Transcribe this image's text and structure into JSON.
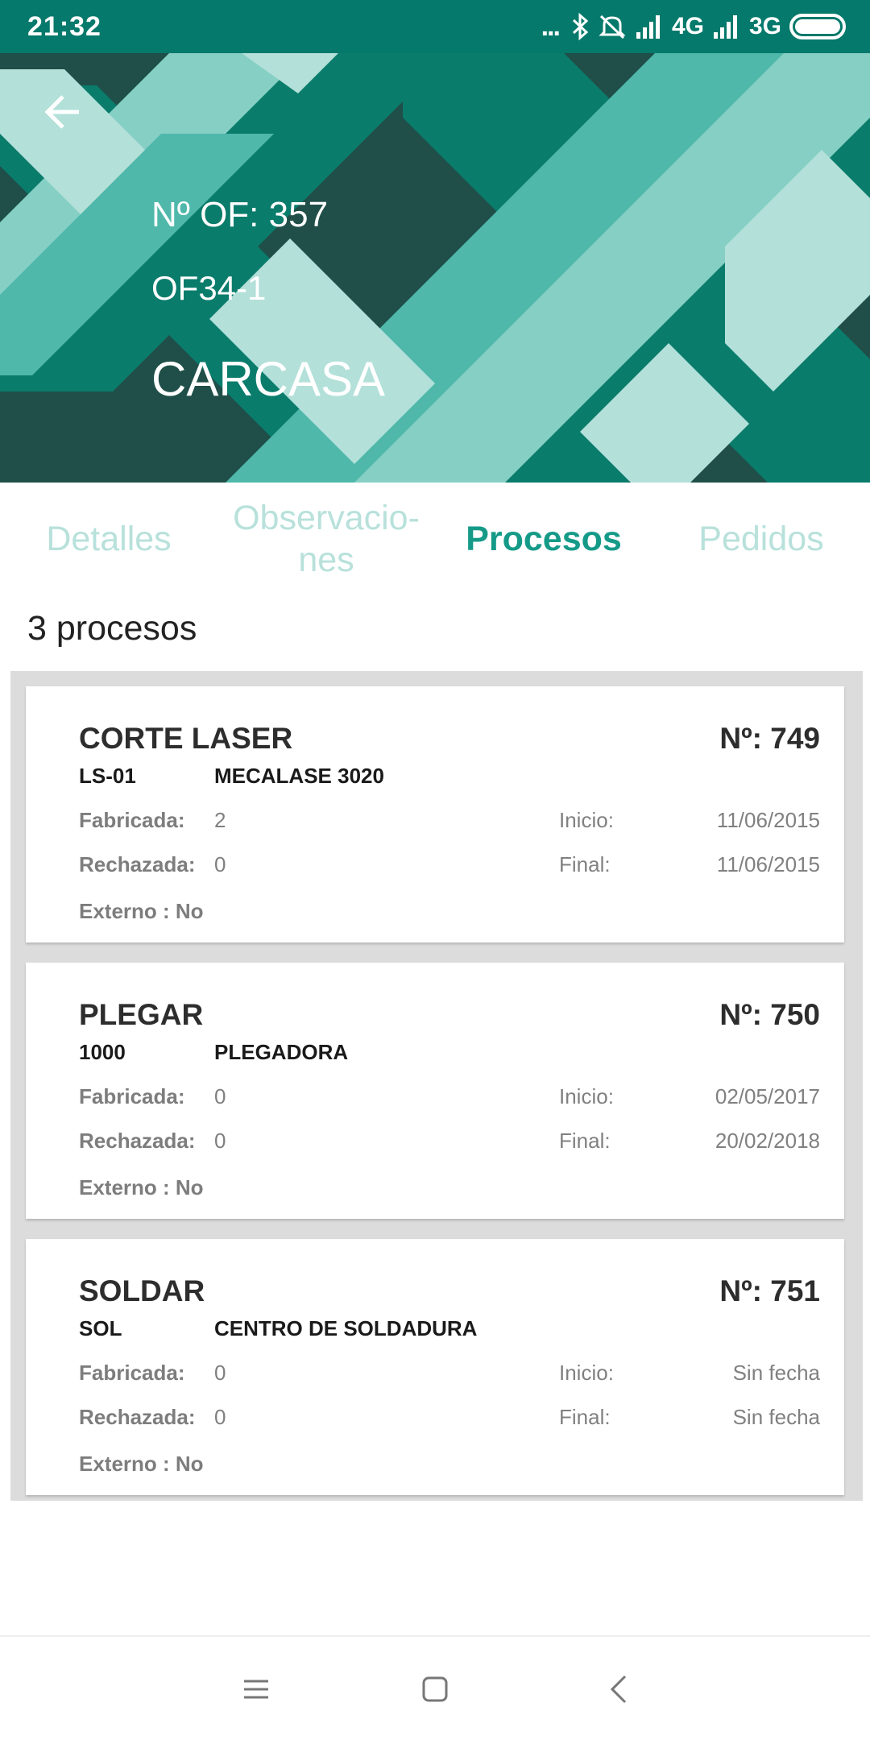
{
  "status_bar": {
    "time": "21:32",
    "dots": "...",
    "network_1": "4G",
    "network_2": "3G",
    "icons": [
      "bluetooth-icon",
      "muted-bell-icon",
      "signal-icon",
      "signal-icon",
      "battery-icon"
    ]
  },
  "header": {
    "of_number": "Nº OF: 357",
    "code": "OF34-1",
    "name": "CARCASA",
    "colors": {
      "dark": "#1f4f48",
      "mid": "#0a7c6c",
      "light": "#4fb8ab",
      "pale": "#86cfc4",
      "palest": "#b3e0d9"
    }
  },
  "tabs": [
    {
      "label": "Detalles",
      "active": false
    },
    {
      "label": "Observacio-\nnes",
      "active": false
    },
    {
      "label": "Procesos",
      "active": true
    },
    {
      "label": "Pedidos",
      "active": false
    }
  ],
  "count_label": "3 procesos",
  "labels": {
    "fabricada": "Fabricada:",
    "rechazada": "Rechazada:",
    "inicio": "Inicio:",
    "final": "Final:"
  },
  "processes": [
    {
      "title": "CORTE LASER",
      "number": "Nº: 749",
      "code": "LS-01",
      "machine": "MECALASE 3020",
      "fabricada": "2",
      "rechazada": "0",
      "inicio": "11/06/2015",
      "final": "11/06/2015",
      "externo": "Externo : No"
    },
    {
      "title": "PLEGAR",
      "number": "Nº: 750",
      "code": "1000",
      "machine": "PLEGADORA",
      "fabricada": "0",
      "rechazada": "0",
      "inicio": "02/05/2017",
      "final": "20/02/2018",
      "externo": "Externo : No"
    },
    {
      "title": "SOLDAR",
      "number": "Nº: 751",
      "code": "SOL",
      "machine": "CENTRO DE SOLDADURA",
      "fabricada": "0",
      "rechazada": "0",
      "inicio": "Sin fecha",
      "final": "Sin fecha",
      "externo": "Externo : No"
    }
  ],
  "accent_color": "#159a88"
}
